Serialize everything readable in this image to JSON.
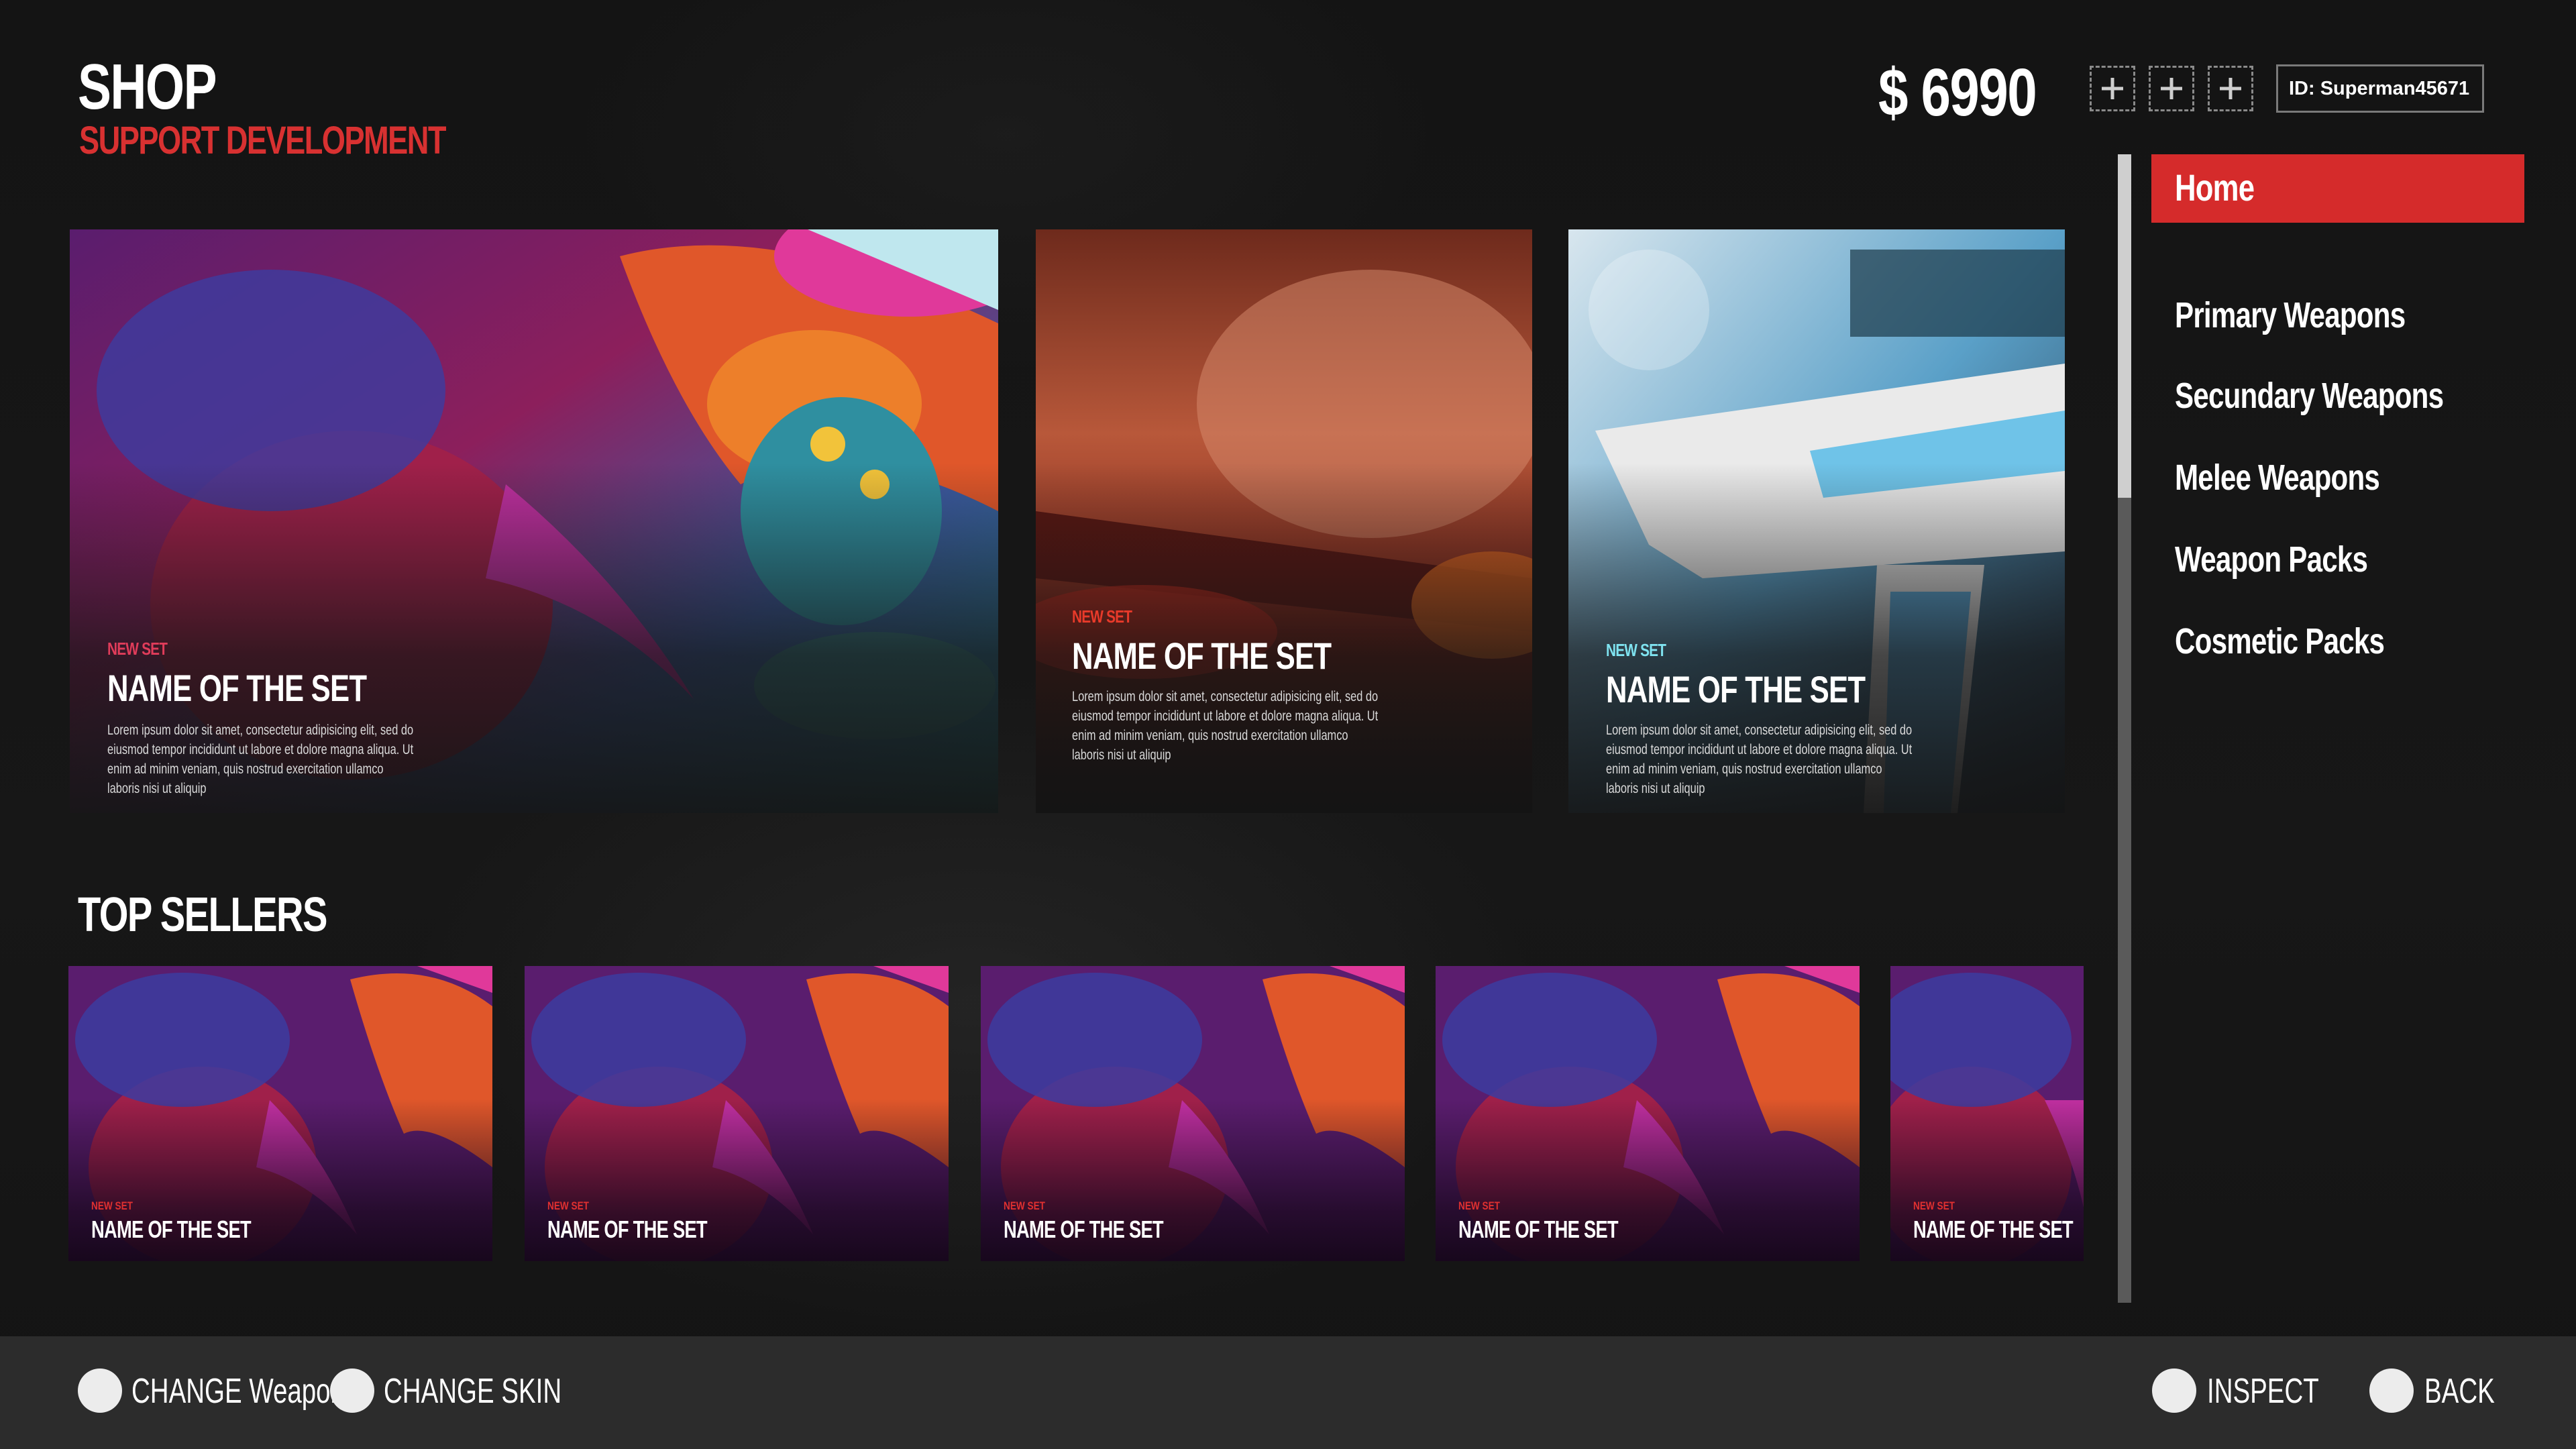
{
  "header": {
    "title": "SHOP",
    "subtitle": "SUPPORT DEVELOPMENT",
    "currency": "$ 6990",
    "user_id": "ID: Superman45671",
    "plus_buttons": [
      "plus-icon",
      "plus-icon",
      "plus-icon"
    ]
  },
  "featured": [
    {
      "tag": "NEW SET",
      "title": "NAME OF THE SET",
      "description": "Lorem ipsum dolor sit amet, consectetur adipisicing elit, sed do eiusmod tempor incididunt ut labore et dolore magna aliqua. Ut enim ad minim veniam, quis nostrud exercitation ullamco laboris nisi ut aliquip",
      "tag_color": "#e03c5a"
    },
    {
      "tag": "NEW SET",
      "title": "NAME OF THE SET",
      "description": "Lorem ipsum dolor sit amet, consectetur adipisicing elit, sed do eiusmod tempor incididunt ut labore et dolore magna aliqua. Ut enim ad minim veniam, quis nostrud exercitation ullamco laboris nisi ut aliquip",
      "tag_color": "#e83a2a"
    },
    {
      "tag": "NEW SET",
      "title": "NAME OF THE SET",
      "description": "Lorem ipsum dolor sit amet, consectetur adipisicing elit, sed do eiusmod tempor incididunt ut labore et dolore magna aliqua. Ut enim ad minim veniam, quis nostrud exercitation ullamco laboris nisi ut aliquip",
      "tag_color": "#7fe3f0"
    }
  ],
  "top_sellers": {
    "title": "TOP SELLERS",
    "items": [
      {
        "tag": "NEW SET",
        "title": "NAME OF THE SET"
      },
      {
        "tag": "NEW SET",
        "title": "NAME OF THE SET"
      },
      {
        "tag": "NEW SET",
        "title": "NAME OF THE SET"
      },
      {
        "tag": "NEW SET",
        "title": "NAME OF THE SET"
      },
      {
        "tag": "NEW SET",
        "title": "NAME OF THE SET"
      }
    ]
  },
  "sidebar": {
    "active": "Home",
    "items": [
      "Primary Weapons",
      "Secundary Weapons",
      "Melee Weapons",
      "Weapon Packs",
      "Cosmetic Packs"
    ],
    "accent": "#d52b2b"
  },
  "footer": {
    "left": [
      {
        "label": "CHANGE Weapon"
      },
      {
        "label": "CHANGE SKIN"
      }
    ],
    "right": [
      {
        "label": "INSPECT"
      },
      {
        "label": "BACK"
      }
    ]
  }
}
